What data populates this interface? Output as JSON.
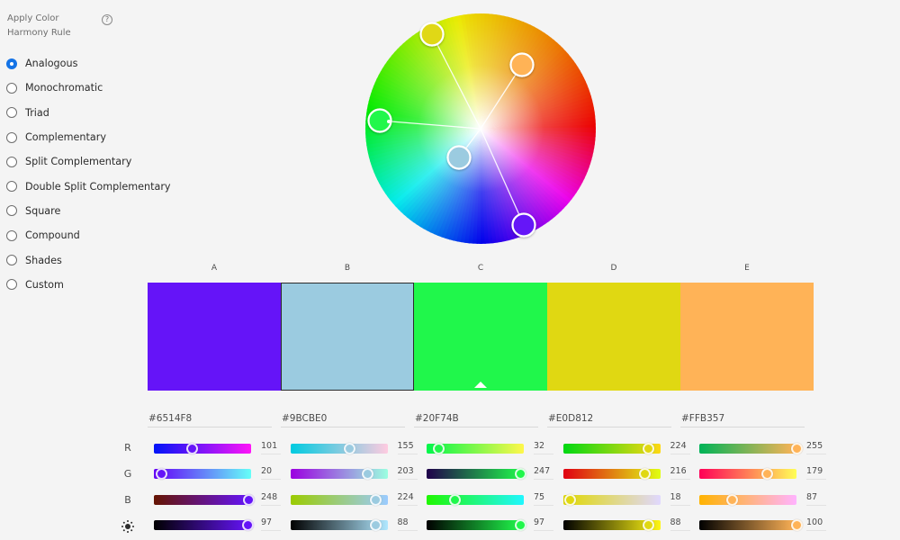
{
  "sidebar": {
    "title": "Apply Color Harmony Rule",
    "help_icon": "question-circle-icon",
    "help_glyph": "?",
    "selected": "Analogous",
    "rules": [
      {
        "label": "Analogous",
        "checked": true
      },
      {
        "label": "Monochromatic",
        "checked": false
      },
      {
        "label": "Triad",
        "checked": false
      },
      {
        "label": "Complementary",
        "checked": false
      },
      {
        "label": "Split Complementary",
        "checked": false
      },
      {
        "label": "Double Split Complementary",
        "checked": false
      },
      {
        "label": "Square",
        "checked": false
      },
      {
        "label": "Compound",
        "checked": false
      },
      {
        "label": "Shades",
        "checked": false
      },
      {
        "label": "Custom",
        "checked": false
      }
    ]
  },
  "wheel": {
    "handles": [
      {
        "swatch": "A",
        "color": "#6514F8"
      },
      {
        "swatch": "B",
        "color": "#9BCBE0"
      },
      {
        "swatch": "C",
        "color": "#20F74B",
        "base": true
      },
      {
        "swatch": "D",
        "color": "#E0D812"
      },
      {
        "swatch": "E",
        "color": "#FFB357"
      }
    ]
  },
  "swatches": [
    {
      "label": "A",
      "hex": "#6514F8",
      "rgb": [
        101,
        20,
        248
      ],
      "brightness": 97,
      "selected": false,
      "base": false
    },
    {
      "label": "B",
      "hex": "#9BCBE0",
      "rgb": [
        155,
        203,
        224
      ],
      "brightness": 88,
      "selected": true,
      "base": false
    },
    {
      "label": "C",
      "hex": "#20F74B",
      "rgb": [
        32,
        247,
        75
      ],
      "brightness": 97,
      "selected": false,
      "base": true
    },
    {
      "label": "D",
      "hex": "#E0D812",
      "rgb": [
        224,
        216,
        18
      ],
      "brightness": 88,
      "selected": false,
      "base": false
    },
    {
      "label": "E",
      "hex": "#FFB357",
      "rgb": [
        255,
        179,
        87
      ],
      "brightness": 100,
      "selected": false,
      "base": false
    }
  ],
  "channels": {
    "labels": [
      "R",
      "G",
      "B"
    ],
    "brightness_icon": "brightness-sun-icon"
  }
}
